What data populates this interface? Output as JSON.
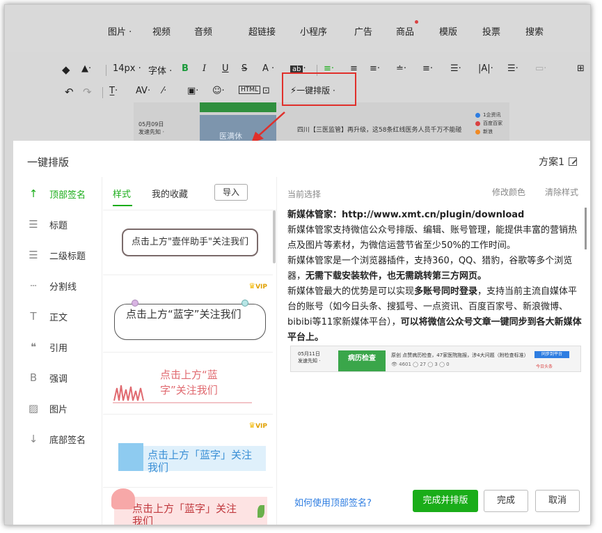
{
  "menu": {
    "items": [
      {
        "label": "图片",
        "caret": "·"
      },
      {
        "label": "视频"
      },
      {
        "label": "音频"
      },
      {
        "label": "超链接"
      },
      {
        "label": "小程序"
      },
      {
        "label": "广告"
      },
      {
        "label": "商品",
        "badge_dot": true
      },
      {
        "label": "模版"
      },
      {
        "label": "投票"
      },
      {
        "label": "搜索"
      }
    ]
  },
  "toolbar": {
    "font_size": "14px ·",
    "font_family": "字体 ·",
    "bold": "B",
    "italic": "I",
    "underline": "U",
    "strike": "S",
    "font_color": "A ·",
    "auto_layout": "一键排版 ·"
  },
  "background_doc": {
    "date": "05月09日",
    "author": "发速先知 ·",
    "image_text": "医满休",
    "news": "四川【三医监管】再升级，这58条红线医务人员千万不能碰",
    "badges": [
      {
        "label": "1企资讯",
        "color": "#2e7de1"
      },
      {
        "label": "百度百家",
        "color": "#d94141"
      },
      {
        "label": "新浪",
        "color": "#f08a24"
      }
    ]
  },
  "modal": {
    "title": "一键排版",
    "scheme": "方案1",
    "categories": [
      {
        "label": "顶部签名",
        "icon": "arrow-up-bar-icon",
        "glyph": "↑",
        "active": true
      },
      {
        "label": "标题",
        "icon": "menu-lines-icon",
        "glyph": "☰"
      },
      {
        "label": "二级标题",
        "icon": "menu-lines-icon",
        "glyph": "☰"
      },
      {
        "label": "分割线",
        "icon": "divider-icon",
        "glyph": "┄"
      },
      {
        "label": "正文",
        "icon": "text-t-icon",
        "glyph": "T"
      },
      {
        "label": "引用",
        "icon": "quote-icon",
        "glyph": "❝"
      },
      {
        "label": "强调",
        "icon": "bold-b-icon",
        "glyph": "B"
      },
      {
        "label": "图片",
        "icon": "image-icon",
        "glyph": "▨"
      },
      {
        "label": "底部签名",
        "icon": "arrow-down-bar-icon",
        "glyph": "↓"
      }
    ],
    "tabs": {
      "styles": "样式",
      "favorites": "我的收藏",
      "import": "导入"
    },
    "style_cards": [
      {
        "text": "点击上方\"壹伴助手\"关注我们",
        "vip": false
      },
      {
        "text": "点击上方“蓝字”关注我们",
        "vip": true
      },
      {
        "text": "点击上方“蓝字”关注我们",
        "vip": false
      },
      {
        "text": "点击上方「蓝字」关注我们",
        "vip": true
      },
      {
        "text": "点击上方「蓝字」关注我们",
        "vip": false
      }
    ],
    "vip_label": "VIP",
    "preview": {
      "current_label": "当前选择",
      "modify_color": "修改颜色",
      "clear_style": "清除样式",
      "heading": "新媒体管家：http://www.xmt.cn/plugin/download",
      "p1": "新媒体管家支持微信公众号排版、编辑、账号管理，能提供丰富的营销热点及图片等素材，为微信运营节省至少50%的工作时间。",
      "p2_a": "新媒体管家是一个浏览器插件，支持360，QQ、猎豹，谷歌等多个浏览器，",
      "p2_b": "无需下载安装软件，也无需跳转第三方网页。",
      "p3_a": "新媒体管最大的优势是可以实现",
      "p3_b": "多账号同时登录",
      "p3_c": "，支持当前主流自媒体平台的账号（如今日头条、搜狐号、一点资讯、百度百家号、新浪微博、bibibi等11家新媒体平台），",
      "p3_d": "可以将微信公众号文章一键同步到各大新媒体平台上。",
      "img": {
        "date": "05月11日",
        "author": "发速先知 ·",
        "green": "病历检查",
        "headline": "原创  点赞病历检查，47家医院拖报，涉4大问题（附检查标准）",
        "stats": "👁 4601   ◯ 27   ◯ 3   ◯ 0",
        "blue": "同步到平台",
        "toutiao": "今日头条"
      }
    },
    "footer": {
      "how_link": "如何使用顶部签名?",
      "primary": "完成并排版",
      "done": "完成",
      "cancel": "取消"
    }
  }
}
